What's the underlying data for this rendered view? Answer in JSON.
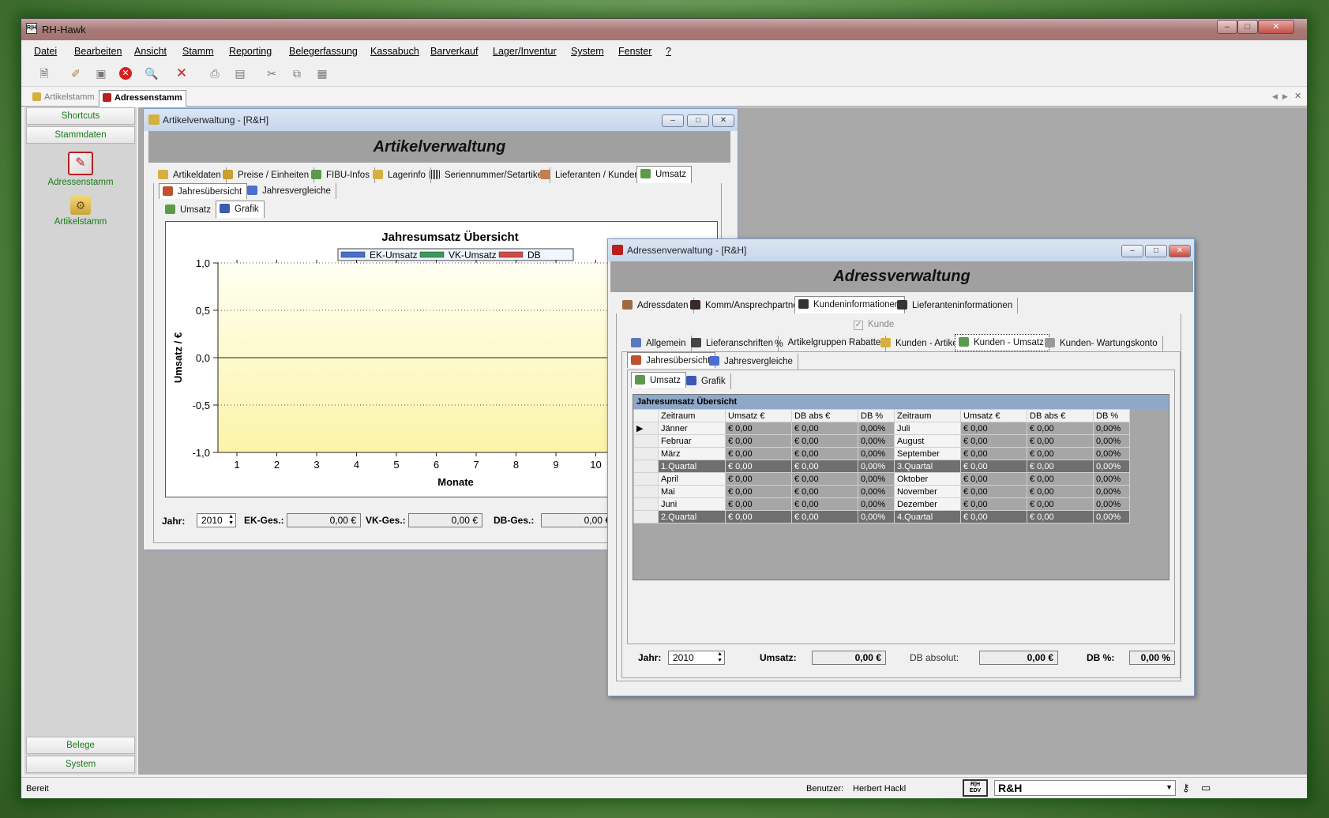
{
  "app": {
    "title": "RH-Hawk",
    "icon": "R|H"
  },
  "menu": [
    "Datei",
    "Bearbeiten",
    "Ansicht",
    "Stamm",
    "Reporting",
    "Belegerfassung",
    "Kassabuch",
    "Barverkauf",
    "Lager/Inventur",
    "System",
    "Fenster",
    "?"
  ],
  "doctabs": [
    "Artikelstamm",
    "Adressenstamm"
  ],
  "leftnav": {
    "top": [
      "Shortcuts",
      "Stammdaten"
    ],
    "items": [
      "Adressenstamm",
      "Artikelstamm"
    ],
    "bottom": [
      "Belege",
      "System"
    ]
  },
  "status": {
    "text": "Bereit",
    "user_label": "Benutzer:",
    "user": "Herbert Hackl",
    "company": "R&H",
    "logo": "R|H EDV"
  },
  "article": {
    "title": "Artikelverwaltung - [R&H]",
    "banner": "Artikelverwaltung",
    "tabs": [
      "Artikeldaten",
      "Preise / Einheiten",
      "FIBU-Infos",
      "Lagerinfo",
      "Seriennummer/Setartikel",
      "Lieferanten / Kunden",
      "Umsatz"
    ],
    "subtabs": [
      "Jahresübersicht",
      "Jahresvergleiche"
    ],
    "subsubtabs": [
      "Umsatz",
      "Grafik"
    ],
    "footer": {
      "year_label": "Jahr:",
      "year": "2010",
      "ek_label": "EK-Ges.:",
      "ek": "0,00 €",
      "vk_label": "VK-Ges.:",
      "vk": "0,00 €",
      "db_label": "DB-Ges.:",
      "db": "0,00 €"
    }
  },
  "chart_data": {
    "type": "line",
    "title": "Jahresumsatz Übersicht",
    "xlabel": "Monate",
    "ylabel": "Umsatz / €",
    "x": [
      1,
      2,
      3,
      4,
      5,
      6,
      7,
      8,
      9,
      10
    ],
    "xtick_labels": [
      "1",
      "2",
      "3",
      "4",
      "5",
      "6",
      "7",
      "8",
      "9",
      "10"
    ],
    "ytick_labels": [
      "1,0",
      "0,5",
      "0,0",
      "-0,5",
      "-1,0"
    ],
    "ylim": [
      -1,
      1
    ],
    "series": [
      {
        "name": "EK-Umsatz",
        "values": [],
        "color": "#4a6fd0"
      },
      {
        "name": "VK-Umsatz",
        "values": [],
        "color": "#3a9a5a"
      },
      {
        "name": "DB",
        "values": [],
        "color": "#d04a4a"
      }
    ],
    "legend": "top",
    "grid": true
  },
  "address": {
    "title": "Adressenverwaltung - [R&H]",
    "banner": "Adressverwaltung",
    "tabs": [
      "Adressdaten",
      "Komm/Ansprechpartner",
      "Kundeninformationen",
      "Lieferanteninformationen"
    ],
    "checkbox": "Kunde",
    "subtabs": [
      "Allgemein",
      "Lieferanschriften",
      "Artikelgruppen Rabatte",
      "Kunden - Artikel",
      "Kunden - Umsatz",
      "Kunden- Wartungskonto"
    ],
    "subsubtabs": [
      "Jahresübersicht",
      "Jahresvergleiche"
    ],
    "innertabs": [
      "Umsatz",
      "Grafik"
    ],
    "grid": {
      "caption": "Jahresumsatz Übersicht",
      "headers": [
        "Zeitraum",
        "Umsatz €",
        "DB abs €",
        "DB %",
        "Zeitraum",
        "Umsatz €",
        "DB abs €",
        "DB %"
      ],
      "rows": [
        [
          "Jänner",
          "€ 0,00",
          "€ 0,00",
          "0,00%",
          "Juli",
          "€ 0,00",
          "€ 0,00",
          "0,00%"
        ],
        [
          "Februar",
          "€ 0,00",
          "€ 0,00",
          "0,00%",
          "August",
          "€ 0,00",
          "€ 0,00",
          "0,00%"
        ],
        [
          "März",
          "€ 0,00",
          "€ 0,00",
          "0,00%",
          "September",
          "€ 0,00",
          "€ 0,00",
          "0,00%"
        ],
        [
          "1.Quartal",
          "€ 0,00",
          "€ 0,00",
          "0,00%",
          "3.Quartal",
          "€ 0,00",
          "€ 0,00",
          "0,00%"
        ],
        [
          "April",
          "€ 0,00",
          "€ 0,00",
          "0,00%",
          "Oktober",
          "€ 0,00",
          "€ 0,00",
          "0,00%"
        ],
        [
          "Mai",
          "€ 0,00",
          "€ 0,00",
          "0,00%",
          "November",
          "€ 0,00",
          "€ 0,00",
          "0,00%"
        ],
        [
          "Juni",
          "€ 0,00",
          "€ 0,00",
          "0,00%",
          "Dezember",
          "€ 0,00",
          "€ 0,00",
          "0,00%"
        ],
        [
          "2.Quartal",
          "€ 0,00",
          "€ 0,00",
          "0,00%",
          "4.Quartal",
          "€ 0,00",
          "€ 0,00",
          "0,00%"
        ]
      ]
    },
    "footer": {
      "year_label": "Jahr:",
      "year": "2010",
      "umsatz_label": "Umsatz:",
      "umsatz": "0,00 €",
      "dbabs_label": "DB absolut:",
      "dbabs": "0,00 €",
      "dbp_label": "DB %:",
      "dbp": "0,00 %"
    }
  }
}
